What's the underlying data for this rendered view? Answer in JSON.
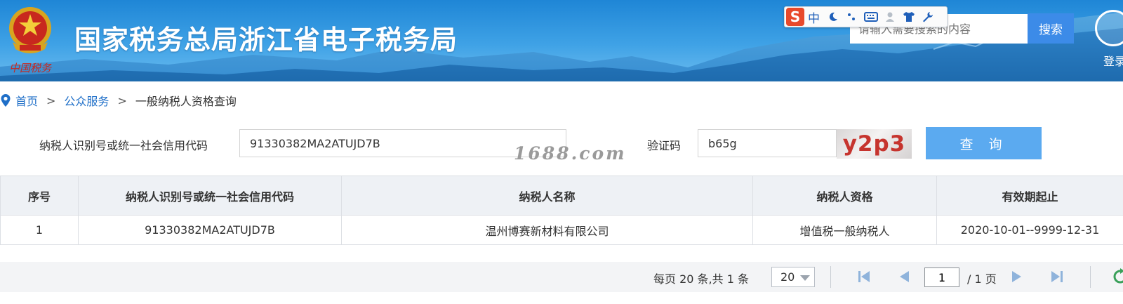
{
  "header": {
    "emblem_caption": "中国税务",
    "site_title": "国家税务总局浙江省电子税务局",
    "search": {
      "placeholder": "请输入需要搜索的内容",
      "button_label": "搜索"
    },
    "login_label": "登录",
    "ime_toolbar": {
      "logo": "S",
      "items": [
        "中",
        "moon-icon",
        "dots-icon",
        "keyboard-icon",
        "user-icon",
        "shirt-icon",
        "wrench-icon"
      ],
      "mode_label": "中"
    }
  },
  "breadcrumb": {
    "home": "首页",
    "separator": ">",
    "section": "公众服务",
    "current": "一般纳税人资格查询"
  },
  "query_form": {
    "taxpayer_id_label": "纳税人识别号或统一社会信用代码",
    "taxpayer_id_value": "91330382MA2ATUJD7B",
    "captcha_label": "验证码",
    "captcha_value": "b65g",
    "captcha_image_text": "y2p3",
    "query_button": "查 询",
    "watermark": "1688.com"
  },
  "results_table": {
    "headers": [
      "序号",
      "纳税人识别号或统一社会信用代码",
      "纳税人名称",
      "纳税人资格",
      "有效期起止"
    ],
    "rows": [
      [
        "1",
        "91330382MA2ATUJD7B",
        "温州博赛新材料有限公司",
        "增值税一般纳税人",
        "2020-10-01--9999-12-31"
      ]
    ]
  },
  "pager": {
    "summary": "每页 20 条,共 1 条",
    "page_size": "20",
    "current_page": "1",
    "total_pages_text": "/ 1 页"
  },
  "colors": {
    "banner_blue": "#1f86d6",
    "link_blue": "#1f6fc8",
    "query_button": "#5baaf0",
    "search_button": "#3c8be8",
    "captcha_text": "#c6342e"
  }
}
